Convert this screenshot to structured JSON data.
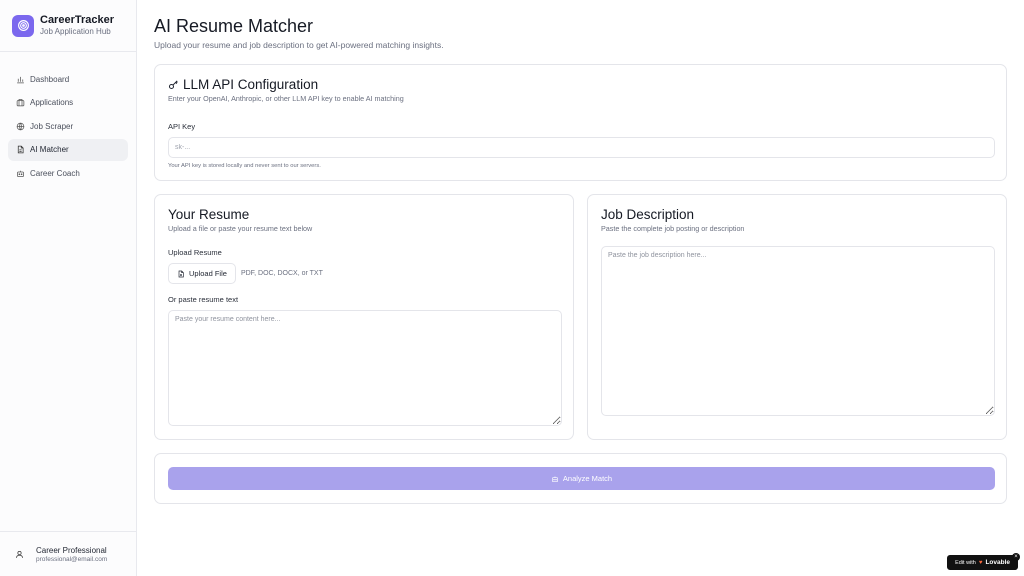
{
  "sidebar": {
    "brand_title": "CareerTracker",
    "brand_subtitle": "Job Application Hub",
    "items": [
      {
        "label": "Dashboard",
        "icon": "bar-chart-icon"
      },
      {
        "label": "Applications",
        "icon": "briefcase-icon"
      },
      {
        "label": "Job Scraper",
        "icon": "globe-icon"
      },
      {
        "label": "AI Matcher",
        "icon": "file-text-icon",
        "active": true
      },
      {
        "label": "Career Coach",
        "icon": "bot-icon"
      }
    ],
    "user": {
      "name": "Career Professional",
      "email": "professional@email.com"
    }
  },
  "page": {
    "title": "AI Resume Matcher",
    "subtitle": "Upload your resume and job description to get AI-powered matching insights."
  },
  "api_config": {
    "title": "LLM API Configuration",
    "description": "Enter your OpenAI, Anthropic, or other LLM API key to enable AI matching",
    "key_label": "API Key",
    "key_placeholder": "sk-...",
    "key_value": "",
    "note": "Your API key is stored locally and never sent to our servers."
  },
  "resume": {
    "title": "Your Resume",
    "description": "Upload a file or paste your resume text below",
    "upload_label": "Upload Resume",
    "upload_button": "Upload File",
    "upload_hint": "PDF, DOC, DOCX, or TXT",
    "paste_label": "Or paste resume text",
    "paste_placeholder": "Paste your resume content here..."
  },
  "job": {
    "title": "Job Description",
    "description": "Paste the complete job posting or description",
    "placeholder": "Paste the job description here..."
  },
  "analyze": {
    "label": "Analyze Match",
    "color": "#a9a2ec"
  },
  "badge": {
    "prefix": "Edit with",
    "brand": "Lovable",
    "close": "×"
  },
  "colors": {
    "accent": "#7b68ee"
  }
}
